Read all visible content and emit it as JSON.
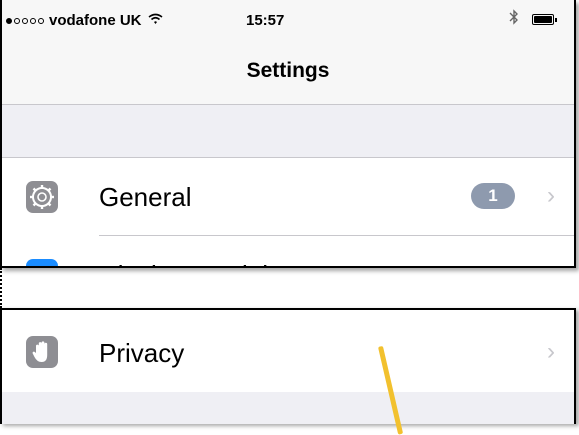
{
  "status_bar": {
    "carrier": "vodafone UK",
    "time": "15:57",
    "bluetooth_symbol": "∗"
  },
  "nav": {
    "title": "Settings"
  },
  "rows": {
    "general": {
      "label": "General",
      "badge": "1",
      "icon": "gear-icon"
    },
    "display": {
      "label": "Display & Brightness",
      "icon": "text-size-icon"
    },
    "privacy": {
      "label": "Privacy",
      "icon": "hand-icon"
    }
  },
  "chevron": "›",
  "colors": {
    "accent_blue": "#1a8cff",
    "icon_gray": "#8e8e93",
    "badge": "#8e9aae",
    "annotation": "#f2c12e"
  }
}
